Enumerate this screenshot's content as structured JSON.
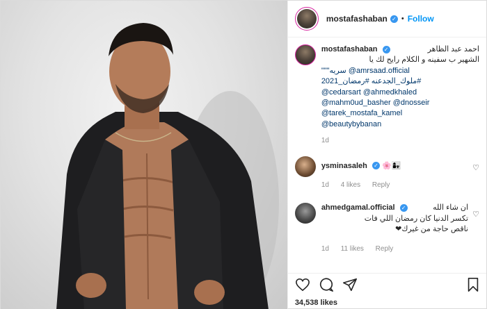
{
  "post": {
    "author": {
      "username": "mostafashaban",
      "verified": true,
      "follow_label": "Follow",
      "separator": "•"
    },
    "caption": {
      "username": "mostafashaban",
      "line1": "احمد عبد الظاهر",
      "line2": "الشهير ب سفينه و الكلام رايح لك يا",
      "line3": "\"\"\"سريه @amrsaad.official",
      "line4": "ملوك_الجدعنه #رمضان_2021#",
      "tags": [
        "@cedarsart @ahmedkhaled",
        "@mahm0ud_basher @dnosseir",
        "@tarek_mostafa_kamel",
        "@beautybybanan"
      ],
      "age": "1d"
    },
    "comments": [
      {
        "username": "ysminasaleh",
        "verified": true,
        "text": "🌸👩‍👧",
        "age": "1d",
        "likes": "4 likes",
        "reply": "Reply"
      },
      {
        "username": "ahmedgamal.official",
        "verified": true,
        "text_line1": "ان شاء الله",
        "text_line2": "تكسر الدنيا كان رمضان اللي فات",
        "text_line3": "ناقص حاجة من غيرك❤",
        "age": "1d",
        "likes": "11 likes",
        "reply": "Reply"
      }
    ],
    "likes_count": "34,538 likes"
  },
  "icons": {
    "like": "heart-icon",
    "comment": "comment-icon",
    "share": "share-icon",
    "save": "bookmark-icon"
  },
  "colors": {
    "link": "#00376b",
    "follow": "#0095f6",
    "verified": "#3897f0",
    "meta": "#8e8e8e"
  }
}
